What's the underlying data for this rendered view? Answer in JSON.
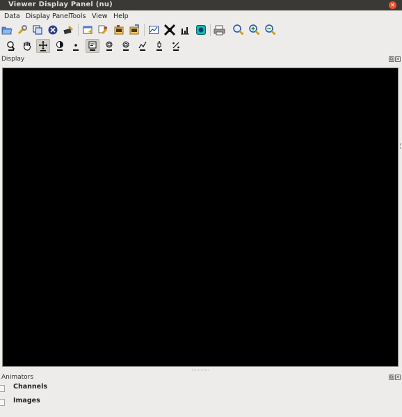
{
  "window": {
    "title": "Viewer Display Panel (nu)",
    "close_glyph": "✕"
  },
  "menubar": {
    "items": [
      {
        "label": "Data"
      },
      {
        "label": "Display Panel"
      },
      {
        "label": "Tools"
      },
      {
        "label": "View"
      },
      {
        "label": "Help"
      }
    ]
  },
  "toolbar_main": {
    "icons": [
      "open-folder-icon",
      "wrench-icon",
      "copy-panel-icon",
      "unregister-data-icon",
      "print-to-file-icon",
      "new-panel-icon",
      "data-options-icon",
      "save-image-icon",
      "export-icon",
      "graph-icon",
      "fullscreen-icon",
      "histogram-icon",
      "color-wedge-icon",
      "print-icon",
      "zoom-icon",
      "zoom-in-icon",
      "zoom-out-icon"
    ]
  },
  "toolbar_mouse": {
    "icons": [
      "zoom-tool-icon",
      "pan-tool-icon",
      "move-tool-icon",
      "contrast-tool-icon",
      "point-tool-icon",
      "annotation-tool-icon",
      "rectangle-tool-icon",
      "polygon-tool-icon",
      "polyline-tool-icon",
      "crosshair-tool-icon",
      "ruler-tool-icon",
      "position-tool-icon"
    ],
    "pressed": [
      "move-tool-icon",
      "annotation-tool-icon"
    ]
  },
  "display_panel": {
    "title": "Display",
    "float_glyph": "⧉",
    "close_glyph": "✕"
  },
  "animators_panel": {
    "title": "Animators",
    "float_glyph": "⧉",
    "close_glyph": "✕"
  },
  "animators": [
    {
      "label": "Channels",
      "checked": false
    },
    {
      "label": "Images",
      "checked": false
    }
  ],
  "colors": {
    "display_background": "#000000",
    "titlebar": "#3a3935",
    "window": "#edecea",
    "close_button": "#e9542f"
  }
}
